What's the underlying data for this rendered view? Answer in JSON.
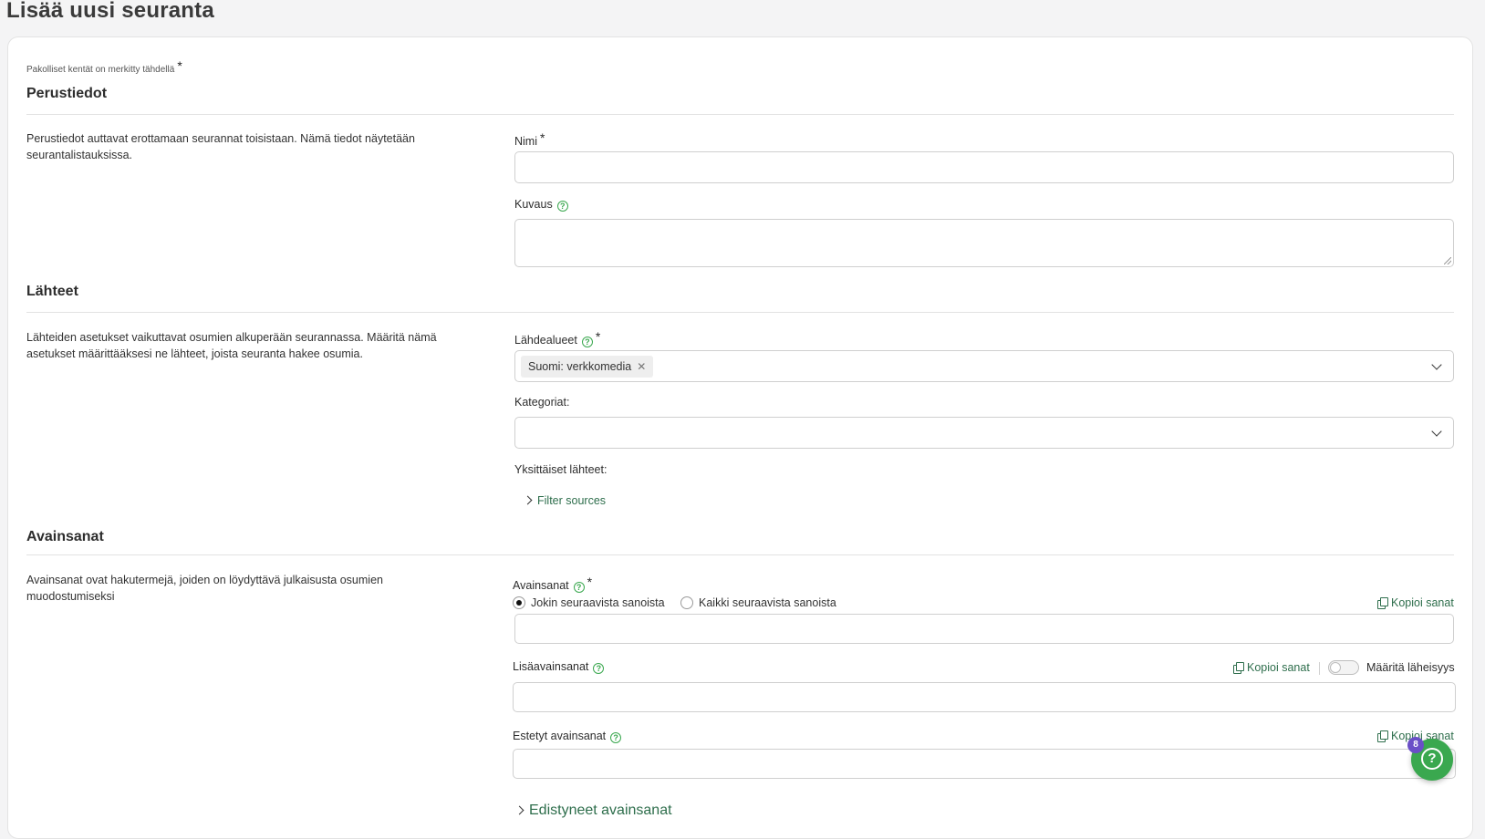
{
  "page": {
    "title": "Lisää uusi seuranta"
  },
  "required_note": "Pakolliset kentät on merkitty tähdellä",
  "required_star": "*",
  "sections": {
    "basic": {
      "title": "Perustiedot",
      "description": "Perustiedot auttavat erottamaan seurannat toisistaan. Nämä tiedot näytetään seurantalistauksissa.",
      "name_label": "Nimi",
      "name_value": "",
      "description_label": "Kuvaus",
      "description_value": ""
    },
    "sources": {
      "title": "Lähteet",
      "description": "Lähteiden asetukset vaikuttavat osumien alkuperään seurannassa. Määritä nämä asetukset määrittääksesi ne lähteet, joista seuranta hakee osumia.",
      "areas_label": "Lähdealueet",
      "areas_selected": [
        "Suomi: verkkomedia"
      ],
      "categories_label": "Kategoriat:",
      "individual_label": "Yksittäiset lähteet:",
      "filter_link": "Filter sources"
    },
    "keywords": {
      "title": "Avainsanat",
      "description": "Avainsanat ovat hakutermejä, joiden on löydyttävä julkaisusta osumien muodostumiseksi",
      "keywords_label": "Avainsanat",
      "radio_any": "Jokin seuraavista sanoista",
      "radio_all": "Kaikki seuraavista sanoista",
      "radio_selected": "any",
      "copy_words": "Kopioi sanat",
      "additional_label": "Lisäavainsanat",
      "proximity_label": "Määritä läheisyys",
      "proximity_enabled": false,
      "blocked_label": "Estetyt avainsanat",
      "advanced_link": "Edistyneet avainsanat"
    }
  },
  "help_fab": {
    "badge": "8"
  },
  "colors": {
    "accent": "#3aa84f",
    "link": "#2e6e4c",
    "badge": "#6a4fc7"
  }
}
